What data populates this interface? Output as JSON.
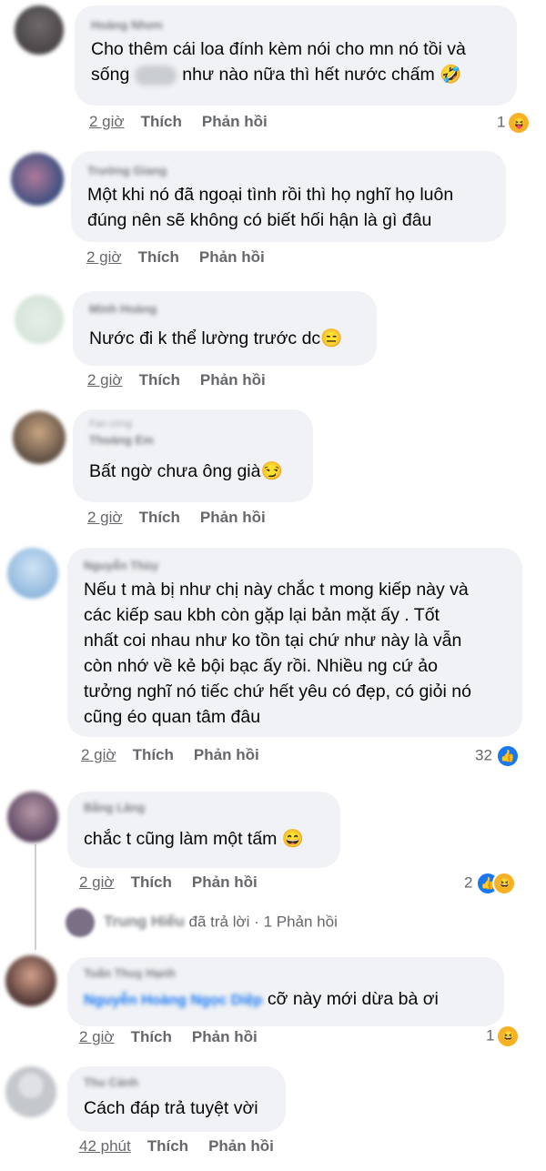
{
  "comments": [
    {
      "author": "Hoàng Nhơn",
      "text_before": "Cho thêm cái loa đính kèm nói cho mn nó tồi và\nsống",
      "text_after": "như nào nữa thì hết nước chấm 🤣",
      "time": "2 giờ",
      "like": "Thích",
      "reply": "Phản hồi",
      "react_count": "1",
      "react_icon": "tongue-face-icon",
      "react_emoji": "😝"
    },
    {
      "author": "Trường Giang",
      "text": "Một khi nó đã ngoại tình rồi thì họ nghĩ họ luôn\nđúng nên sẽ không có biết hối hận là gì đâu",
      "time": "2 giờ",
      "like": "Thích",
      "reply": "Phản hồi"
    },
    {
      "author": "Minh Hoàng",
      "text": "Nước đi k thể lường trước dc😑",
      "time": "2 giờ",
      "like": "Thích",
      "reply": "Phản hồi"
    },
    {
      "author_sub": "Fan cứng",
      "author": "Thoàng Em",
      "text": "Bất ngờ chưa ông già😏",
      "time": "2 giờ",
      "like": "Thích",
      "reply": "Phản hồi"
    },
    {
      "author": "Nguyễn Thùy",
      "text": "Nếu t mà bị như chị này chắc t mong kiếp này và\ncác kiếp sau kbh còn gặp lại bản mặt ấy . Tốt\nnhất coi nhau như ko tồn tại chứ như này là vẫn\ncòn nhớ về kẻ bội bạc ấy rồi. Nhiều ng cứ ảo\ntưởng nghĩ nó tiếc chứ hết yêu có đẹp, có giỏi nó\ncũng éo quan tâm đâu",
      "time": "2 giờ",
      "like": "Thích",
      "reply": "Phản hồi",
      "react_count": "32",
      "react_icon": "like-icon",
      "react_emoji": "👍"
    },
    {
      "author": "Bằng Lăng",
      "text": "chắc t cũng làm một tấm 😄",
      "time": "2 giờ",
      "like": "Thích",
      "reply": "Phản hồi",
      "react_count": "2",
      "react_icon": "like-haha-icon",
      "react_emoji": "👍",
      "react_emoji2": "😆",
      "replies": {
        "author": "Trung Hiếu",
        "action": "đã trả lời",
        "dot": "·",
        "count": "1 Phản hồi"
      }
    },
    {
      "author": "Tuấn Thuỵ Hạnh",
      "mention": "Nguyễn Hoàng Ngọc Diệp",
      "text": "cỡ này mới dừa bà ơi",
      "time": "2 giờ",
      "like": "Thích",
      "reply": "Phản hồi",
      "react_count": "1",
      "react_icon": "haha-icon",
      "react_emoji": "😆"
    },
    {
      "author": "Thu Cảnh",
      "text": "Cách đáp trả tuyệt vời",
      "time": "42 phút",
      "like": "Thích",
      "reply": "Phản hồi"
    }
  ],
  "colors": {
    "bubble": "#f0f2f5",
    "meta": "#65676b",
    "link": "#1877f2"
  }
}
